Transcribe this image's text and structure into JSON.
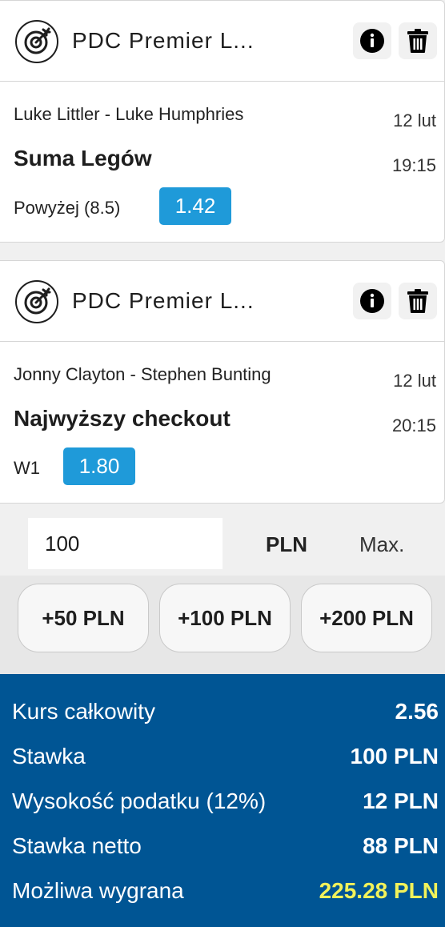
{
  "bets": [
    {
      "league": "PDC Premier L...",
      "match": "Luke Littler - Luke Humphries",
      "date": "12 lut",
      "market": "Suma Legów",
      "time": "19:15",
      "selection": "Powyżej (8.5)",
      "odds": "1.42"
    },
    {
      "league": "PDC Premier L...",
      "match": "Jonny Clayton - Stephen Bunting",
      "date": "12 lut",
      "market": "Najwyższy checkout",
      "time": "20:15",
      "selection": "W1",
      "odds": "1.80"
    }
  ],
  "stake": {
    "value": "100",
    "currency": "PLN",
    "max_label": "Max."
  },
  "quick_stakes": [
    "+50 PLN",
    "+100 PLN",
    "+200 PLN"
  ],
  "summary": {
    "total_odds_label": "Kurs całkowity",
    "total_odds_value": "2.56",
    "stake_label": "Stawka",
    "stake_value": "100 PLN",
    "tax_label": "Wysokość podatku (12%)",
    "tax_value": "12 PLN",
    "net_stake_label": "Stawka netto",
    "net_stake_value": "88 PLN",
    "possible_win_label": "Możliwa wygrana",
    "possible_win_value": "225.28 PLN"
  },
  "colors": {
    "odds_badge": "#1f9ad9",
    "summary_bg": "#005594",
    "possible_win": "#f2f25a"
  },
  "icons": {
    "sport": "darts-target-icon",
    "info": "info-icon",
    "delete": "trash-icon"
  }
}
